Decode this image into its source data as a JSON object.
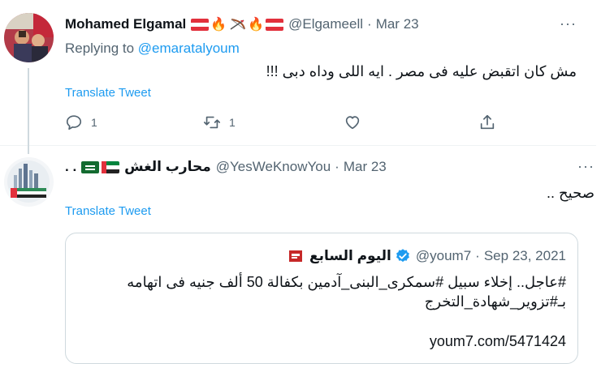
{
  "tweet1": {
    "author_name": "Mohamed Elgamal",
    "handle": "@Elgameell",
    "separator": "·",
    "date": "Mar 23",
    "replying_prefix": "Replying to",
    "replying_handle": "@emaratalyoum",
    "text": "مش كان اتقبض عليه فى مصر  .  ايه اللى وداه دبى !!!",
    "translate_label": "Translate Tweet",
    "reply_count": "1",
    "retweet_count": "1",
    "more_label": "···"
  },
  "tweet2": {
    "author_name": "محارب الغش",
    "name_suffix": ". .",
    "handle": "@YesWeKnowYou",
    "separator": "·",
    "date": "Mar 23",
    "text": "صحيح ..",
    "translate_label": "Translate Tweet",
    "more_label": "···",
    "quote": {
      "author_name": "اليوم السابع",
      "handle": "@youm7",
      "separator": "·",
      "date": "Sep 23, 2021",
      "text": "#عاجل.. إخلاء سبيل #سمكرى_البنى_آدمين بكفالة 50 ألف جنيه فى اتهامه بـ#تزوير_شهادة_التخرج",
      "link": "youm7.com/5471424"
    }
  },
  "colors": {
    "link_blue": "#1d9bf0",
    "secondary_text": "#536471",
    "primary_text": "#0f1419",
    "border": "#cfd9de",
    "verified": "#1d9bf0"
  },
  "icons": {
    "reply": "reply-icon",
    "retweet": "retweet-icon",
    "like": "heart-icon",
    "share": "share-icon",
    "more": "more-icon",
    "verified": "verified-badge-icon"
  }
}
